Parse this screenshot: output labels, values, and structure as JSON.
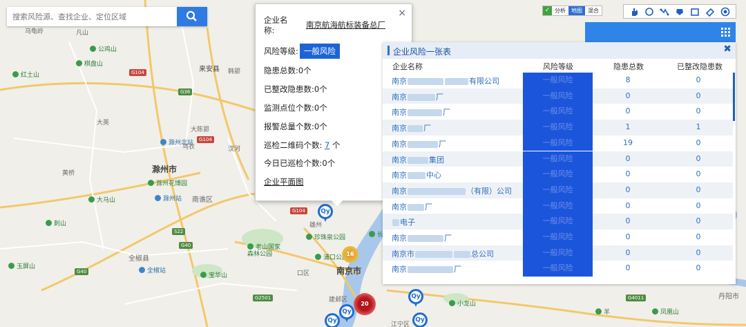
{
  "search": {
    "placeholder": "搜索风险源、查找企业、定位区域"
  },
  "map": {
    "places": [
      {
        "t": "乌龟岭",
        "k": "dark"
      },
      {
        "t": "凡山",
        "k": "dark"
      },
      {
        "t": "公鸡山",
        "k": "green"
      },
      {
        "t": "棋盘山",
        "k": "green"
      },
      {
        "t": "红土山",
        "k": "green"
      },
      {
        "t": "来安县",
        "k": "dark"
      },
      {
        "t": "滁州北站",
        "k": "blue"
      },
      {
        "t": "滁州市",
        "k": "city"
      },
      {
        "t": "滁州花博园",
        "k": "green"
      },
      {
        "t": "大马山",
        "k": "green"
      },
      {
        "t": "滁州站",
        "k": "blue"
      },
      {
        "t": "南谯区",
        "k": "dark"
      },
      {
        "t": "刺山",
        "k": "green"
      },
      {
        "t": "全椒县",
        "k": "dark"
      },
      {
        "t": "全椒站",
        "k": "blue"
      },
      {
        "t": "玉屏山",
        "k": "green"
      },
      {
        "t": "宝华山",
        "k": "green"
      },
      {
        "t": "老山国家森林公园",
        "k": "green"
      },
      {
        "t": "珍珠泉公园",
        "k": "green"
      },
      {
        "t": "浦口公园",
        "k": "green"
      },
      {
        "t": "南京市",
        "k": "city"
      },
      {
        "t": "建邺区",
        "k": "dark"
      },
      {
        "t": "小龙山",
        "k": "green"
      },
      {
        "t": "丹阳市",
        "k": "dark"
      },
      {
        "t": "凤凰山",
        "k": "green"
      },
      {
        "t": "羊",
        "k": "green"
      },
      {
        "t": "韩郢",
        "k": "dark"
      },
      {
        "t": "大英",
        "k": "dark"
      },
      {
        "t": "乌衣",
        "k": "dark"
      },
      {
        "t": "大陈郢",
        "k": "dark"
      },
      {
        "t": "黄桥",
        "k": "dark"
      },
      {
        "t": "汊河",
        "k": "dark"
      },
      {
        "t": "长江",
        "k": "dark"
      },
      {
        "t": "江宁区",
        "k": "dark"
      },
      {
        "t": "口区",
        "k": "dark"
      },
      {
        "t": "雄州",
        "k": "dark"
      }
    ],
    "clusters": [
      {
        "count": "16"
      },
      {
        "count": "20"
      }
    ],
    "pin_label": "Qy"
  },
  "popup": {
    "name_label": "企业名称:",
    "name_value": "南京航海航标装备总厂",
    "risk_label": "风险等级:",
    "risk_value": "一般风险",
    "hazards_label": "隐患总数:",
    "hazards_value": "0个",
    "rectified_label": "已整改隐患数:",
    "rectified_value": "0个",
    "monitor_label": "监测点位个数:",
    "monitor_value": "0个",
    "alarm_label": "报警总量个数:",
    "alarm_value": "0个",
    "qr_label": "巡检二维码个数:",
    "qr_value": "7",
    "qr_unit": "个",
    "today_label": "今日已巡检个数:",
    "today_value": "0个",
    "floorplan_link": "企业平面图"
  },
  "toolbar": {
    "analysis": "分析",
    "map": "地图",
    "hybrid": "混合",
    "tools": [
      "hand-icon",
      "circle-icon",
      "polyline-icon",
      "polygon-icon",
      "rectangle-icon",
      "eraser-icon",
      "locate-icon"
    ]
  },
  "panel": {
    "title": "企业风险一张表",
    "close": "✖",
    "columns": [
      "企业名称",
      "风险等级",
      "隐患总数",
      "已整改隐患数"
    ],
    "rows": [
      {
        "pre": "南京",
        "blur": [
          52,
          34
        ],
        "suf": "有限公司",
        "level": "一般风险",
        "hazards": "8",
        "rectified": "0"
      },
      {
        "pre": "南京",
        "blur": [
          40
        ],
        "suf": "厂",
        "level": "一般风险",
        "hazards": "0",
        "rectified": "0"
      },
      {
        "pre": "南京",
        "blur": [
          50
        ],
        "suf": "厂",
        "level": "一般风险",
        "hazards": "0",
        "rectified": "0"
      },
      {
        "pre": "南京",
        "blur": [
          22
        ],
        "suf": "厂",
        "level": "一般风险",
        "hazards": "1",
        "rectified": "1"
      },
      {
        "pre": "南京",
        "blur": [
          44
        ],
        "suf": "厂",
        "level": "一般风险",
        "hazards": "19",
        "rectified": "0"
      },
      {
        "pre": "南京",
        "blur": [
          30
        ],
        "suf": "集团",
        "level": "一般风险",
        "hazards": "0",
        "rectified": "0"
      },
      {
        "pre": "南京",
        "blur": [
          26
        ],
        "suf": "中心",
        "level": "一般风险",
        "hazards": "0",
        "rectified": "0"
      },
      {
        "pre": "南京",
        "blur": [
          84
        ],
        "suf": "（有限）公司",
        "level": "一般风险",
        "hazards": "0",
        "rectified": "0"
      },
      {
        "pre": "南京",
        "blur": [
          24
        ],
        "suf": "厂",
        "level": "一般风险",
        "hazards": "0",
        "rectified": "0"
      },
      {
        "pre": "",
        "blur": [
          10
        ],
        "suf": "电子",
        "level": "一般风险",
        "hazards": "0",
        "rectified": "0"
      },
      {
        "pre": "南京",
        "blur": [
          52
        ],
        "suf": "厂",
        "level": "一般风险",
        "hazards": "0",
        "rectified": "0"
      },
      {
        "pre": "南京市",
        "blur": [
          54,
          24
        ],
        "suf": "总公司",
        "level": "一般风险",
        "hazards": "0",
        "rectified": "0"
      },
      {
        "pre": "南京",
        "blur": [
          66
        ],
        "suf": "厂",
        "level": "一般风险",
        "hazards": "0",
        "rectified": "0"
      }
    ]
  },
  "colors": {
    "accent": "#2e7be3",
    "risk": "#1b55db",
    "link": "#1a5fc2"
  }
}
